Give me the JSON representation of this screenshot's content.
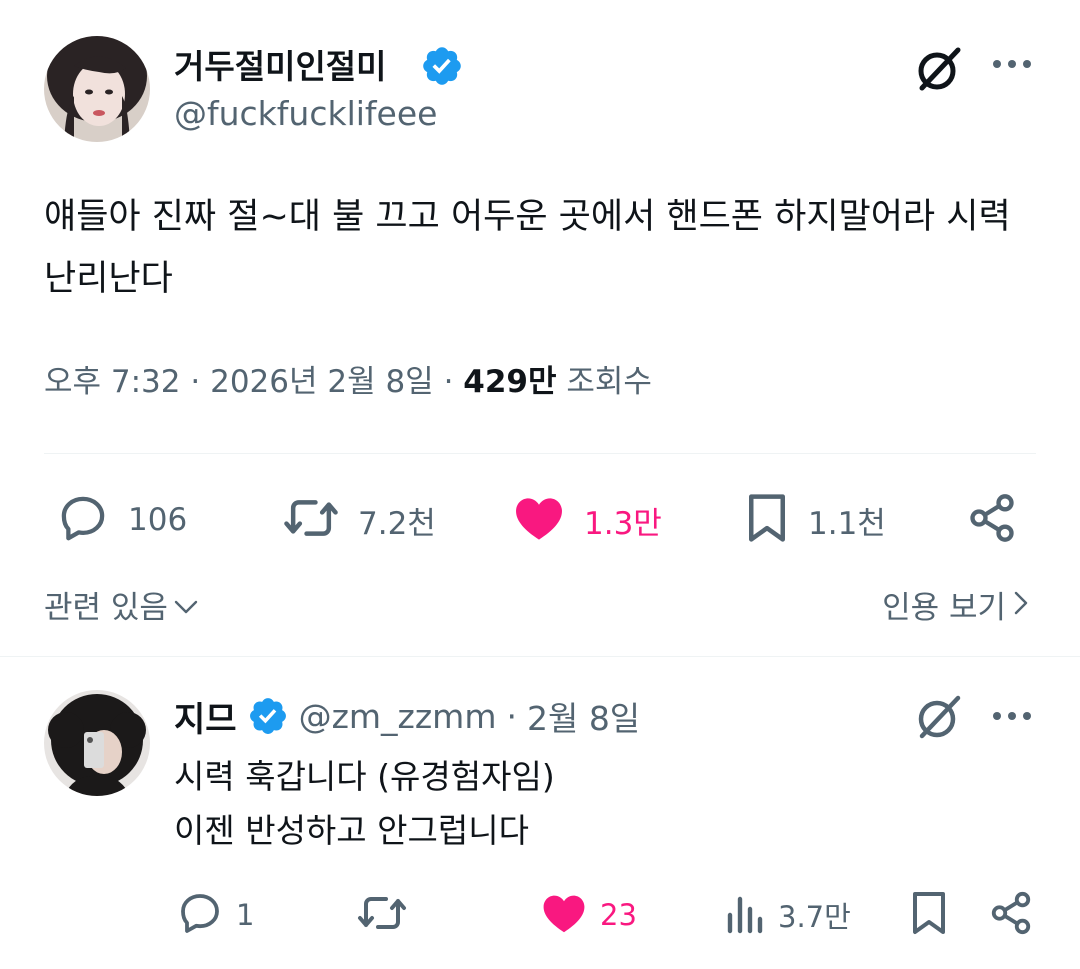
{
  "main_tweet": {
    "author_name": "거두절미인절미",
    "handle": "@fuckfucklifeee",
    "text": "얘들아 진짜 절~대 불 끄고 어두운 곳에서 핸드폰 하지말어라 시력 난리난다",
    "time": "오후 7:32",
    "date": "2026년 2월 8일",
    "views_count": "429만",
    "views_label": "조회수",
    "stats": {
      "replies": "106",
      "retweets": "7.2천",
      "likes": "1.3만",
      "bookmarks": "1.1천"
    },
    "related_label": "관련 있음",
    "quotes_label": "인용 보기"
  },
  "reply": {
    "author_name": "지므",
    "handle": "@zm_zzmm",
    "date": "2월 8일",
    "text": "시력 훅갑니다 (유경험자임)\n이젠 반성하고 안그럽니다",
    "stats": {
      "replies": "1",
      "likes": "23",
      "views": "3.7만"
    }
  },
  "colors": {
    "verified": "#1d9bf0",
    "like": "#f91880",
    "secondary_text": "#536471",
    "divider": "#eff3f4"
  },
  "icons": [
    "verified-badge-icon",
    "grok-icon",
    "more-icon",
    "reply-icon",
    "retweet-icon",
    "heart-icon",
    "bookmark-icon",
    "share-icon",
    "views-icon",
    "chevron-down-icon",
    "chevron-right-icon"
  ]
}
